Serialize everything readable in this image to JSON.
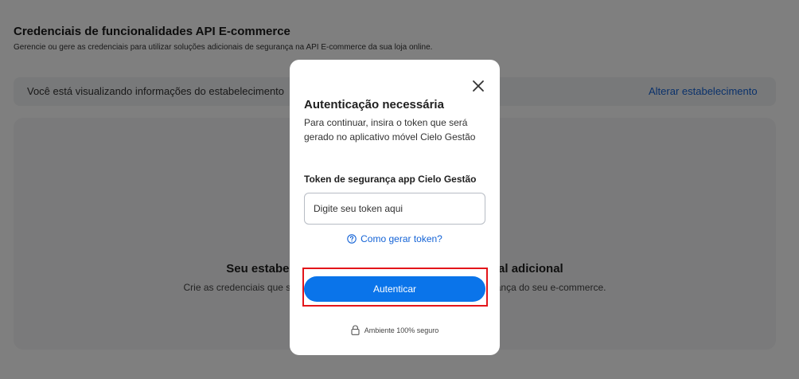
{
  "page": {
    "title": "Credenciais de funcionalidades API E-commerce",
    "subtitle": "Gerencie ou gere as credenciais para utilizar soluções adicionais de segurança na API E-commerce da sua loja online.",
    "info_text": "Você está visualizando informações do estabelecimento",
    "change_link": "Alterar estabelecimento",
    "empty_title": "Seu estabelecimento ainda não possui credencial adicional",
    "empty_desc": "Crie as credenciais que serão utilizadas nas soluções adicionais de segurança do seu e-commerce."
  },
  "modal": {
    "close_icon": "close-icon",
    "title": "Autenticação necessária",
    "description": "Para continuar, insira o token que será gerado no aplicativo móvel Cielo Gestão",
    "field_label": "Token de segurança app Cielo Gestão",
    "input_placeholder": "Digite seu token aqui",
    "input_value": "",
    "help_link": "Como gerar token?",
    "help_icon": "question-circle-icon",
    "button_label": "Autenticar",
    "secure_text": "Ambiente 100% seguro",
    "secure_icon": "lock-icon"
  },
  "colors": {
    "accent": "#0a74ea",
    "link": "#1463d6",
    "highlight": "#e3151a"
  }
}
